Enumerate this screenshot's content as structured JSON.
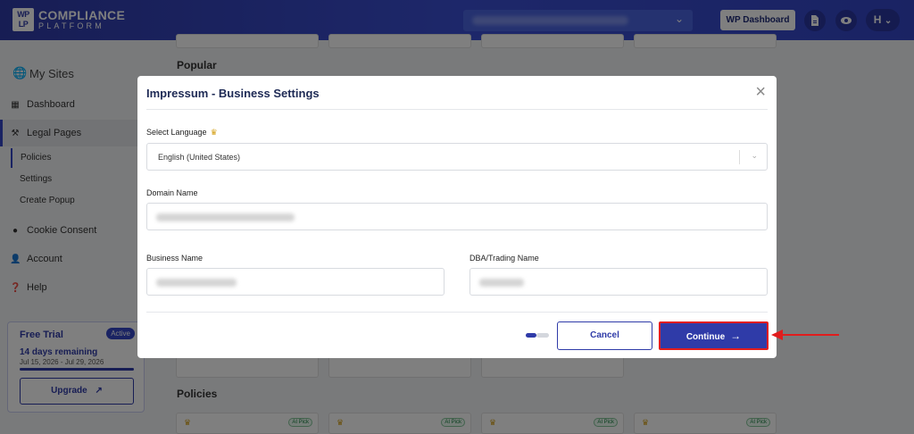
{
  "header": {
    "logo_mark": "WP LP",
    "logo_line1": "COMPLIANCE",
    "logo_line2": "PLATFORM",
    "wp_dashboard": "WP Dashboard",
    "user_initial": "H",
    "icons": [
      "document-icon",
      "eye-icon",
      "chevron-down-icon"
    ]
  },
  "sidebar": {
    "my_sites": "My Sites",
    "dashboard": "Dashboard",
    "legal_pages": "Legal Pages",
    "sub": {
      "policies": "Policies",
      "settings": "Settings",
      "create_popup": "Create Popup"
    },
    "cookie_consent": "Cookie Consent",
    "account": "Account",
    "help": "Help",
    "trial": {
      "title": "Free Trial",
      "badge": "Active",
      "remaining": "14 days remaining",
      "dates": "Jul 15, 2026 - Jul 29, 2026",
      "progress_fraction": 1.0,
      "upgrade": "Upgrade"
    }
  },
  "main": {
    "popular_heading": "Popular",
    "policies_heading": "Policies",
    "ai_pick": "AI Pick"
  },
  "modal": {
    "title": "Impressum - Business Settings",
    "language_label": "Select Language",
    "language_value": "English (United States)",
    "domain_label": "Domain Name",
    "business_label": "Business Name",
    "dba_label": "DBA/Trading Name",
    "cancel": "Cancel",
    "continue": "Continue",
    "close_glyph": "×",
    "step_current": 1,
    "step_total": 2
  },
  "colors": {
    "brand": "#2f3ba8",
    "annotation": "#e11d1d",
    "premium": "#d4a017"
  }
}
